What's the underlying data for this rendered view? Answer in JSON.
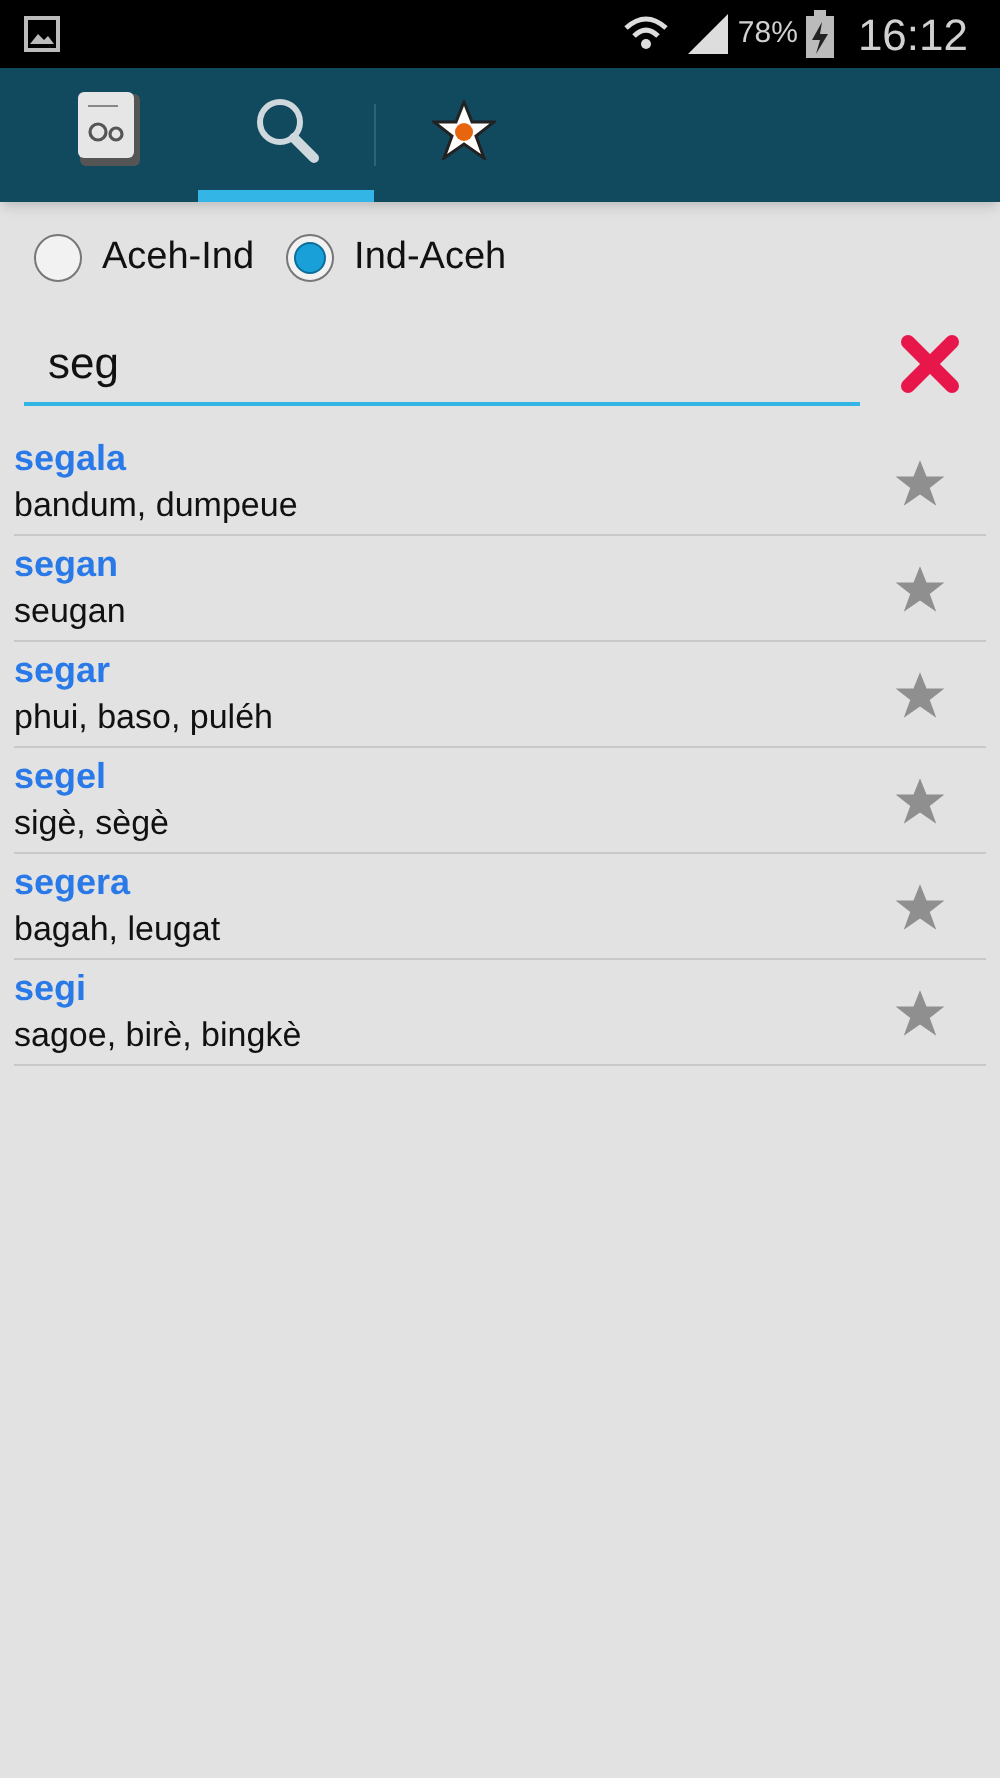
{
  "status_bar": {
    "battery": "78%",
    "time": "16:12"
  },
  "tabs": [
    {
      "kind": "dictionary",
      "selected": false
    },
    {
      "kind": "search",
      "selected": true
    },
    {
      "kind": "favorites",
      "selected": false
    }
  ],
  "directions": [
    {
      "label": "Aceh-Ind",
      "selected": false
    },
    {
      "label": "Ind-Aceh",
      "selected": true
    }
  ],
  "search": {
    "value": "seg"
  },
  "results": [
    {
      "word": "segala",
      "meaning": "bandum, dumpeue",
      "favorite": false
    },
    {
      "word": "segan",
      "meaning": "seugan",
      "favorite": false
    },
    {
      "word": "segar",
      "meaning": "phui, baso, puléh",
      "favorite": false
    },
    {
      "word": "segel",
      "meaning": "sigè, sègè",
      "favorite": false
    },
    {
      "word": "segera",
      "meaning": "bagah, leugat",
      "favorite": false
    },
    {
      "word": "segi",
      "meaning": "sagoe, birè, bingkè",
      "favorite": false
    }
  ]
}
